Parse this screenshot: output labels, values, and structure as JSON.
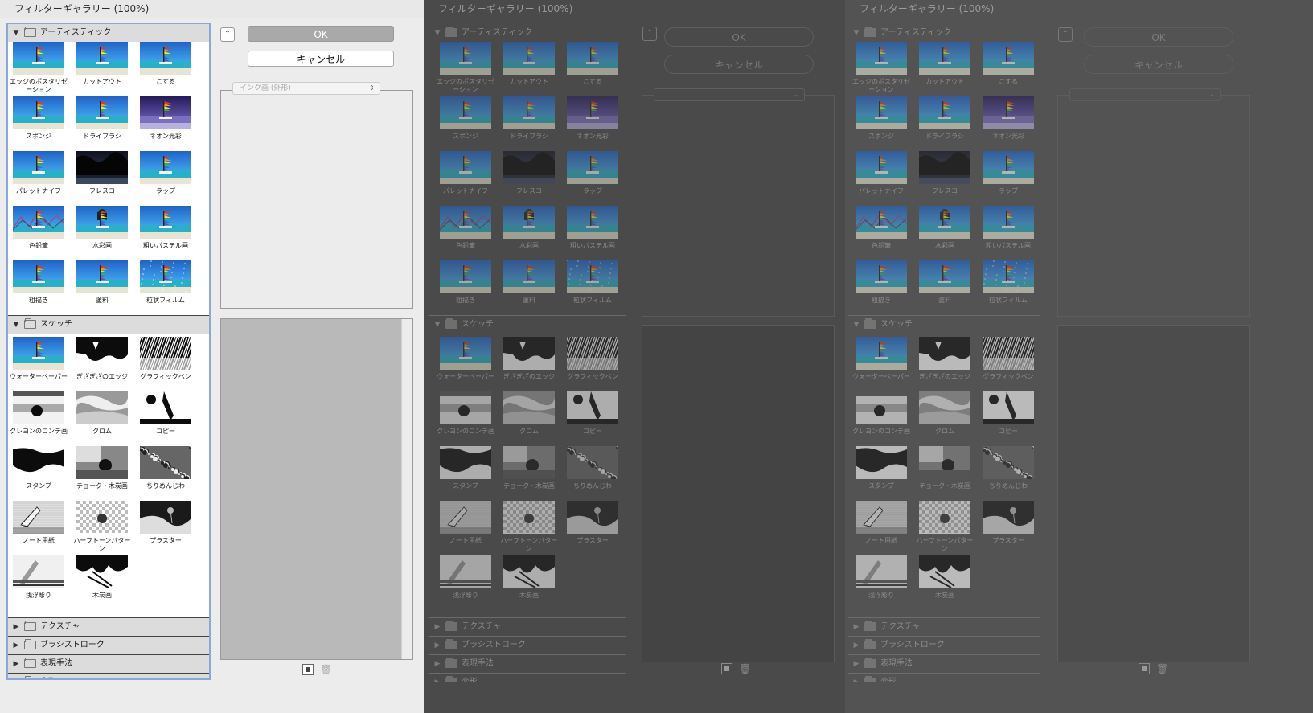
{
  "windows": [
    {
      "title": "フィルターギャラリー (100%)",
      "ok_label": "OK",
      "cancel_label": "キャンセル",
      "filter_select": "インク画 (外形)"
    },
    {
      "title": "フィルターギャラリー (100%)",
      "ok_label": "OK",
      "cancel_label": "キャンセル",
      "filter_select": ""
    },
    {
      "title": "フィルターギャラリー (100%)",
      "ok_label": "OK",
      "cancel_label": "キャンセル",
      "filter_select": ""
    }
  ],
  "categories": {
    "artistic": {
      "label": "アーティスティック",
      "filters": [
        "エッジのポスタリゼーション",
        "カットアウト",
        "こする",
        "スポンジ",
        "ドライブラシ",
        "ネオン光彩",
        "パレットナイフ",
        "フレスコ",
        "ラップ",
        "色鉛筆",
        "水彩画",
        "粗いパステル画",
        "粗描き",
        "塗料",
        "粒状フィルム"
      ]
    },
    "sketch": {
      "label": "スケッチ",
      "filters": [
        "ウォーターペーパー",
        "ぎざぎざのエッジ",
        "グラフィックペン",
        "クレヨンのコンテ画",
        "クロム",
        "コピー",
        "スタンプ",
        "チョーク・木炭画",
        "ちりめんじわ",
        "ノート用紙",
        "ハーフトーンパターン",
        "プラスター",
        "浅浮彫り",
        "木炭画"
      ]
    },
    "collapsed": [
      {
        "label": "テクスチャ"
      },
      {
        "label": "ブラシストローク"
      },
      {
        "label": "表現手法"
      },
      {
        "label": "変形"
      }
    ]
  },
  "icons": {
    "disclosure_open": "triangle-down-icon",
    "disclosure_closed": "triangle-right-icon",
    "folder": "folder-icon",
    "collapse_panel": "collapse-panel-icon",
    "new_effect_layer": "new-effect-layer-icon",
    "delete_effect_layer": "trash-icon"
  },
  "colors": {
    "light_bg": "#ececec",
    "light_list_bg": "#ffffff",
    "light_header_bg": "#dcdcdc",
    "dark_bg": "#4a4a4a",
    "dark_bg_alt": "#535353",
    "dark_panel": "#464646",
    "dark_text": "#8a8a8a"
  }
}
